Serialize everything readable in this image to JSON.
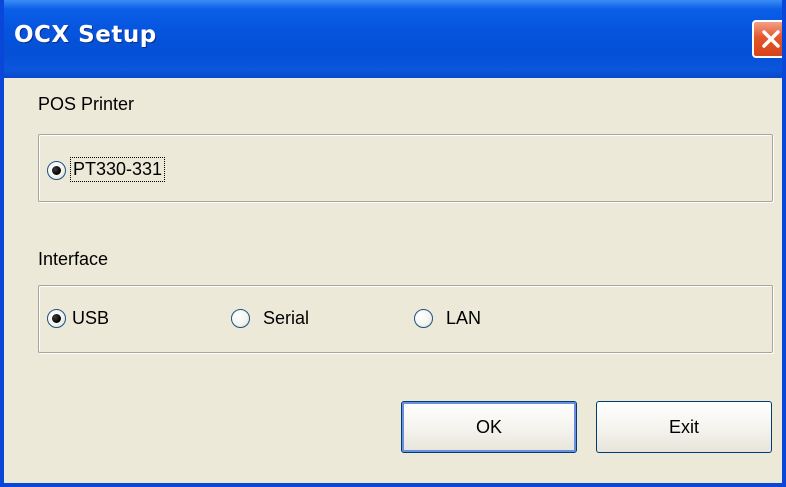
{
  "window": {
    "title": "OCX Setup",
    "close_icon": "close-icon"
  },
  "pos_printer": {
    "label": "POS Printer",
    "options": [
      {
        "label": "PT330-331",
        "selected": true
      }
    ]
  },
  "interface": {
    "label": "Interface",
    "options": [
      {
        "label": "USB",
        "selected": true
      },
      {
        "label": "Serial",
        "selected": false
      },
      {
        "label": "LAN",
        "selected": false
      }
    ]
  },
  "buttons": {
    "ok_label": "OK",
    "exit_label": "Exit"
  },
  "colors": {
    "titlebar": "#0654dd",
    "dialog_bg": "#ece9d8",
    "close_button": "#e4572a"
  }
}
